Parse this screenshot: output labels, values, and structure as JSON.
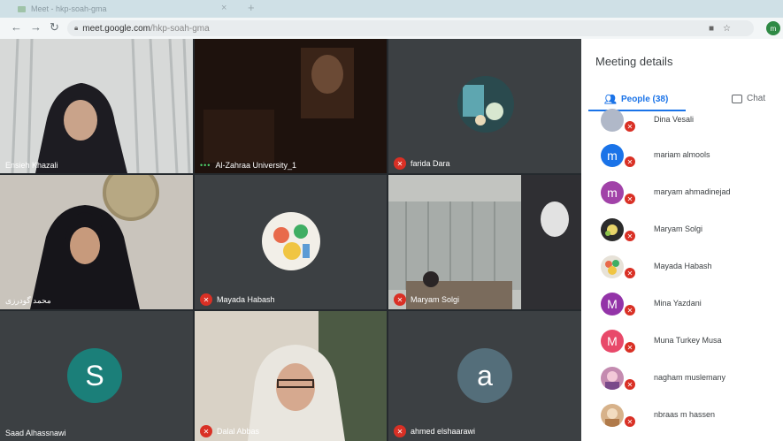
{
  "browser": {
    "tab_title": "Meet - hkp-soah-gma",
    "url_host": "meet.google.com",
    "url_path": "/hkp-soah-gma",
    "profile_initial": "m"
  },
  "tiles": [
    {
      "name": "Ensieh Khazali"
    },
    {
      "name": "Al-Zahraa University_1"
    },
    {
      "name": "farida Dara"
    },
    {
      "name": "محمد گودرزی"
    },
    {
      "name": "Mayada Habash"
    },
    {
      "name": "Maryam Solgi"
    },
    {
      "name": "Saad Alhassnawi",
      "initial": "S"
    },
    {
      "name": "Dalal Abbas"
    },
    {
      "name": "ahmed elshaarawi",
      "initial": "a"
    }
  ],
  "panel": {
    "title": "Meeting details",
    "people_tab": "People (38)",
    "chat_tab": "Chat",
    "participants": [
      {
        "name": "Dina Vesali",
        "initial": "",
        "color": "#b0b8c8"
      },
      {
        "name": "mariam almools",
        "initial": "m",
        "color": "#1a73e8"
      },
      {
        "name": "maryam ahmadinejad",
        "initial": "m",
        "color": "#a142a8"
      },
      {
        "name": "Maryam Solgi",
        "initial": "",
        "color": "#2b2b2b"
      },
      {
        "name": "Mayada Habash",
        "initial": "",
        "color": "#e7e2d8"
      },
      {
        "name": "Mina Yazdani",
        "initial": "M",
        "color": "#9334a8"
      },
      {
        "name": "Muna Turkey Musa",
        "initial": "M",
        "color": "#e8496a"
      },
      {
        "name": "nagham muslemany",
        "initial": "",
        "color": "#c48bb0"
      },
      {
        "name": "nbraas m hassen",
        "initial": "",
        "color": "#d7b28a"
      }
    ]
  }
}
